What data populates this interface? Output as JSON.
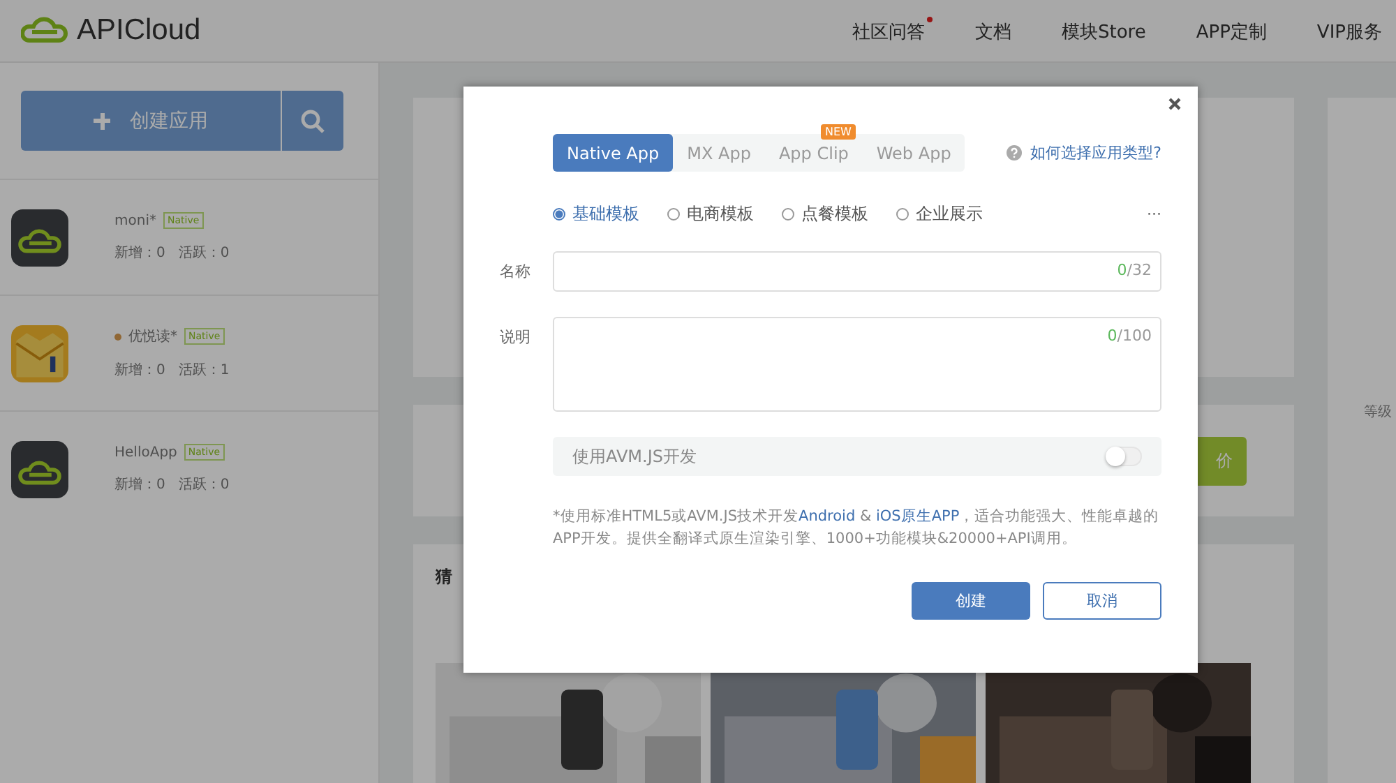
{
  "header": {
    "logo_text": "APICloud",
    "nav": [
      {
        "label": "社区问答",
        "dot": true
      },
      {
        "label": "文档",
        "dot": false
      },
      {
        "label": "模块Store",
        "dot": false
      },
      {
        "label": "APP定制",
        "dot": false
      },
      {
        "label": "VIP服务",
        "dot": false
      }
    ]
  },
  "sidebar": {
    "create_button": "创建应用",
    "apps": [
      {
        "name": "moni*",
        "kind": "cloud",
        "dot": false,
        "tag": "Native",
        "stats": "新增：0   活跃：0"
      },
      {
        "name": "优悦读*",
        "kind": "book",
        "dot": true,
        "tag": "Native",
        "stats": "新增：0   活跃：1"
      },
      {
        "name": "HelloApp",
        "kind": "cloud",
        "dot": false,
        "tag": "Native",
        "stats": "新增：0   活跃：0"
      }
    ]
  },
  "background": {
    "guess_heading": "猜",
    "price_button": "价",
    "level_label": "等级"
  },
  "dialog": {
    "tabs": [
      {
        "label": "Native App",
        "selected": true
      },
      {
        "label": "MX App",
        "selected": false
      },
      {
        "label": "App Clip",
        "selected": false,
        "badge": "NEW"
      },
      {
        "label": "Web App",
        "selected": false
      }
    ],
    "help_link": "如何选择应用类型?",
    "templates": [
      {
        "label": "基础模板",
        "selected": true
      },
      {
        "label": "电商模板",
        "selected": false
      },
      {
        "label": "点餐模板",
        "selected": false
      },
      {
        "label": "企业展示",
        "selected": false
      }
    ],
    "more": "···",
    "fields": [
      {
        "label": "名称",
        "kind": "input",
        "count": "0",
        "max": "/32"
      },
      {
        "label": "说明",
        "kind": "textarea",
        "count": "0",
        "max": "/100"
      }
    ],
    "toggle": {
      "label": "使用AVM.JS开发",
      "on": false
    },
    "note": "*使用标准HTML5或AVM.JS技术开发**Android** & **iOS原生APP**，适合功能强大、性能卓越的APP开发。提供全翻译式原生渲染引擎、1000+功能模块&20000+API调用。",
    "buttons": [
      {
        "label": "创建",
        "kind": "primary"
      },
      {
        "label": "取消",
        "kind": "secondary"
      }
    ]
  }
}
